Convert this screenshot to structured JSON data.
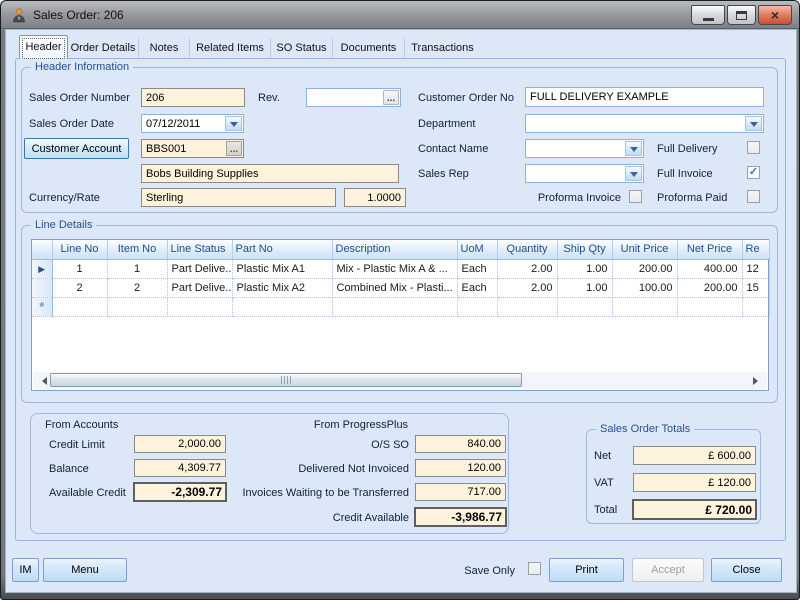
{
  "icons": {
    "close_glyph": "×",
    "check_glyph": "✓",
    "ellipsis_glyph": "...",
    "current_row_glyph": "▶",
    "new_row_glyph": "*"
  },
  "window": {
    "title": "Sales Order: 206"
  },
  "tabs": {
    "active": "Header",
    "items": [
      "Header",
      "Order Details",
      "Notes",
      "Related Items",
      "SO Status",
      "Documents",
      "Transactions"
    ]
  },
  "header_info": {
    "legend": "Header Information",
    "sales_order_number": {
      "label": "Sales Order Number",
      "value": "206"
    },
    "rev": {
      "label": "Rev.",
      "value": ""
    },
    "customer_order_no": {
      "label": "Customer Order No",
      "value": "FULL DELIVERY EXAMPLE"
    },
    "sales_order_date": {
      "label": "Sales Order Date",
      "value": "07/12/2011"
    },
    "department": {
      "label": "Department",
      "value": ""
    },
    "customer_account": {
      "button_label": "Customer Account",
      "code": "BBS001",
      "name": "Bobs Building Supplies"
    },
    "contact_name": {
      "label": "Contact Name",
      "value": ""
    },
    "sales_rep": {
      "label": "Sales Rep",
      "value": ""
    },
    "currency_rate": {
      "label": "Currency/Rate",
      "currency": "Sterling",
      "rate": "1.0000"
    },
    "full_delivery": {
      "label": "Full Delivery",
      "checked": false
    },
    "full_invoice": {
      "label": "Full Invoice",
      "checked": true
    },
    "proforma_invoice": {
      "label": "Proforma Invoice",
      "checked": false
    },
    "proforma_paid": {
      "label": "Proforma Paid",
      "checked": false
    }
  },
  "line_details": {
    "legend": "Line Details",
    "columns": [
      "Line No",
      "Item No",
      "Line Status",
      "Part No",
      "Description",
      "UoM",
      "Quantity",
      "Ship Qty",
      "Unit Price",
      "Net Price",
      "Re"
    ],
    "rows": [
      {
        "cells": [
          "1",
          "1",
          "Part Delive...",
          "Plastic Mix A1",
          "Mix - Plastic Mix A & ...",
          "Each",
          "2.00",
          "1.00",
          "200.00",
          "400.00",
          "12"
        ]
      },
      {
        "cells": [
          "2",
          "2",
          "Part Delive...",
          "Plastic Mix A2",
          "Combined Mix - Plasti...",
          "Each",
          "2.00",
          "1.00",
          "100.00",
          "200.00",
          "15"
        ]
      }
    ]
  },
  "accounts": {
    "title": "From Accounts",
    "credit_limit": {
      "label": "Credit Limit",
      "value": "2,000.00"
    },
    "balance": {
      "label": "Balance",
      "value": "4,309.77"
    },
    "available_credit": {
      "label": "Available Credit",
      "value": "-2,309.77"
    }
  },
  "progressplus": {
    "title": "From ProgressPlus",
    "os_so": {
      "label": "O/S SO",
      "value": "840.00"
    },
    "delivered_not_invoiced": {
      "label": "Delivered Not Invoiced",
      "value": "120.00"
    },
    "invoices_waiting": {
      "label": "Invoices Waiting to be Transferred",
      "value": "717.00"
    },
    "credit_available": {
      "label": "Credit Available",
      "value": "-3,986.77"
    }
  },
  "totals": {
    "legend": "Sales Order Totals",
    "net": {
      "label": "Net",
      "value": "£ 600.00"
    },
    "vat": {
      "label": "VAT",
      "value": "£ 120.00"
    },
    "total": {
      "label": "Total",
      "value": "£ 720.00"
    }
  },
  "footer": {
    "im": "IM",
    "menu": "Menu",
    "save_only": "Save Only",
    "print": "Print",
    "accept": "Accept",
    "close": "Close"
  }
}
